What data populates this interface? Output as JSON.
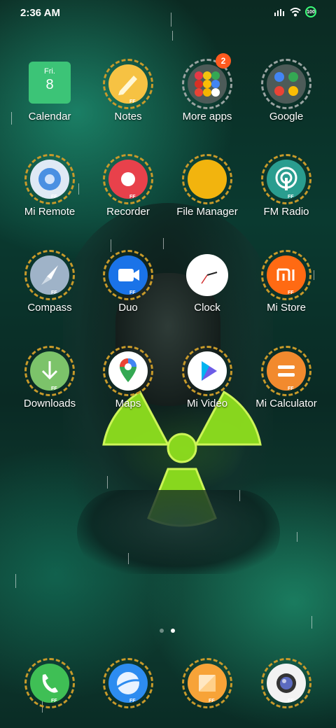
{
  "status_bar": {
    "time": "2:36 AM",
    "battery": "100",
    "icons": [
      "signal-icon",
      "wifi-icon",
      "battery-icon"
    ]
  },
  "calendar_widget": {
    "day": "Fri.",
    "date": "8"
  },
  "apps": [
    {
      "label": "Calendar"
    },
    {
      "label": "Notes"
    },
    {
      "label": "More apps",
      "badge": "2"
    },
    {
      "label": "Google"
    },
    {
      "label": "Mi Remote"
    },
    {
      "label": "Recorder"
    },
    {
      "label": "File Manager"
    },
    {
      "label": "FM Radio"
    },
    {
      "label": "Compass"
    },
    {
      "label": "Duo"
    },
    {
      "label": "Clock"
    },
    {
      "label": "Mi Store"
    },
    {
      "label": "Downloads"
    },
    {
      "label": "Maps"
    },
    {
      "label": "Mi Video"
    },
    {
      "label": "Mi Calculator"
    }
  ],
  "dock": [
    {
      "icon": "phone-icon"
    },
    {
      "icon": "browser-icon"
    },
    {
      "icon": "gallery-icon"
    },
    {
      "icon": "camera-icon"
    }
  ],
  "icon_badge_text": "FF",
  "page_indicator": {
    "pages": 2,
    "active": 2
  },
  "colors": {
    "accent": "#3cff7a",
    "badge": "#ff5a1f",
    "frame": "#c89a2a"
  }
}
